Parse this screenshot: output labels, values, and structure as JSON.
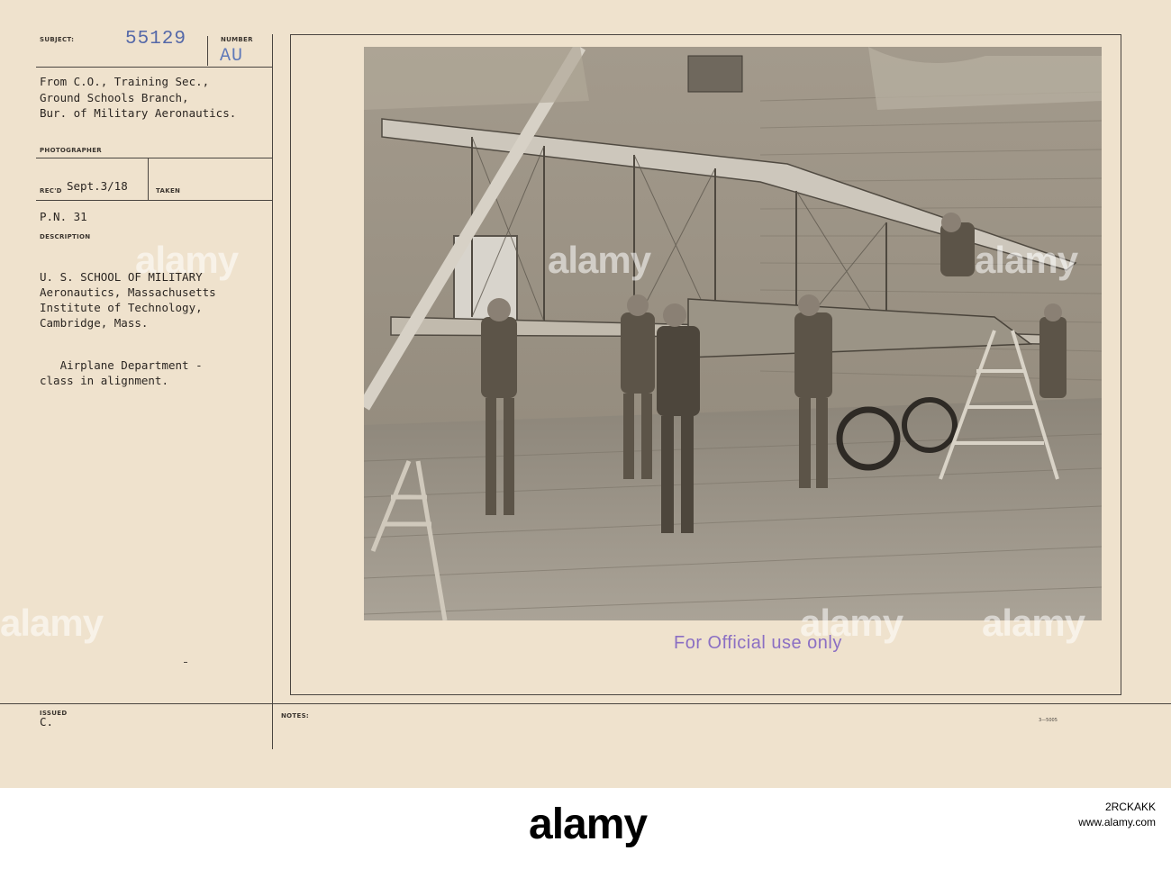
{
  "card": {
    "subject_label": "SUBJECT:",
    "number_label": "NUMBER",
    "photo_number": "55129",
    "series_code": "AU",
    "from_lines": [
      "From C.O., Training Sec.,",
      "Ground Schools Branch,",
      "Bur. of Military Aeronautics."
    ],
    "photographer_label": "PHOTOGRAPHER",
    "recd_label": "REC'D",
    "recd_value": "Sept.3/18",
    "taken_label": "TAKEN",
    "pn_value": "P.N. 31",
    "description_label": "DESCRIPTION",
    "description_lines": [
      "U. S. SCHOOL OF MILITARY",
      "Aeronautics, Massachusetts",
      "Institute of Technology,",
      "Cambridge, Mass."
    ],
    "caption_lines": [
      "   Airplane Department -",
      "class in alignment."
    ],
    "issued_label": "ISSUED",
    "issued_value": "C.",
    "notes_label": "NOTES:",
    "form_code": "3—5005",
    "official_stamp": "For Official use only"
  },
  "watermark": {
    "text": "alamy",
    "bottom_logo": "alamy",
    "image_id": "2RCKAKK",
    "site": "www.alamy.com"
  },
  "colors": {
    "card_bg": "#efe2cd",
    "stamp_blue": "#5468a8",
    "stamp_purple": "#8b6fc3"
  }
}
